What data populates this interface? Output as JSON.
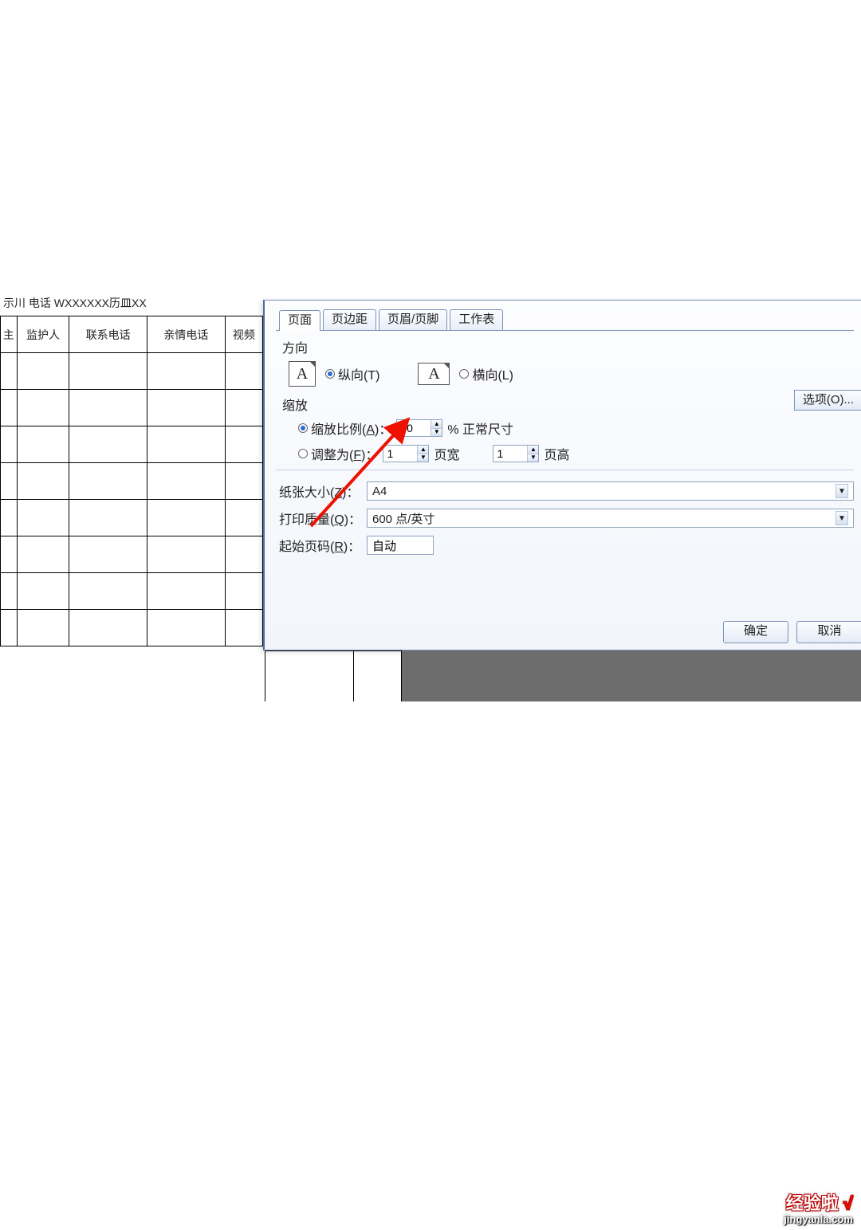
{
  "sheet": {
    "title_fragment": "示川 电话 WXXXXXX历皿XX",
    "headers": [
      "主",
      "监护人",
      "联系电话",
      "亲情电话",
      "视频"
    ],
    "empty_rows": 8
  },
  "dialog": {
    "tabs": [
      {
        "label": "页面",
        "active": true
      },
      {
        "label": "页边距",
        "active": false
      },
      {
        "label": "页眉/页脚",
        "active": false
      },
      {
        "label": "工作表",
        "active": false
      }
    ],
    "orientation": {
      "section_label": "方向",
      "portrait_label": "纵向(T)",
      "landscape_label": "横向(L)",
      "portrait_glyph": "A",
      "landscape_glyph": "A"
    },
    "scaling": {
      "section_label": "缩放",
      "adjust_label_prefix": "缩放比例(",
      "adjust_accel": "A",
      "adjust_label_suffix": ")：",
      "adjust_value": "90",
      "adjust_unit": "% 正常尺寸",
      "fit_label_prefix": "调整为(",
      "fit_accel": "F",
      "fit_label_suffix": ")：",
      "fit_wide_value": "1",
      "fit_wide_label": "页宽",
      "fit_tall_value": "1",
      "fit_tall_label": "页高"
    },
    "options_btn": "选项(O)...",
    "paper_size": {
      "label_prefix": "纸张大小(",
      "accel": "Z",
      "label_suffix": ")：",
      "value": "A4"
    },
    "print_quality": {
      "label_prefix": "打印质量(",
      "accel": "Q",
      "label_suffix": ")：",
      "value": "600 点/英寸"
    },
    "start_page": {
      "label_prefix": "起始页码(",
      "accel": "R",
      "label_suffix": ")：",
      "value": "自动"
    },
    "buttons": {
      "ok": "确定",
      "cancel": "取消"
    }
  },
  "watermark": {
    "brand": "经验啦",
    "check": "√",
    "url": "jingyanla.com"
  }
}
